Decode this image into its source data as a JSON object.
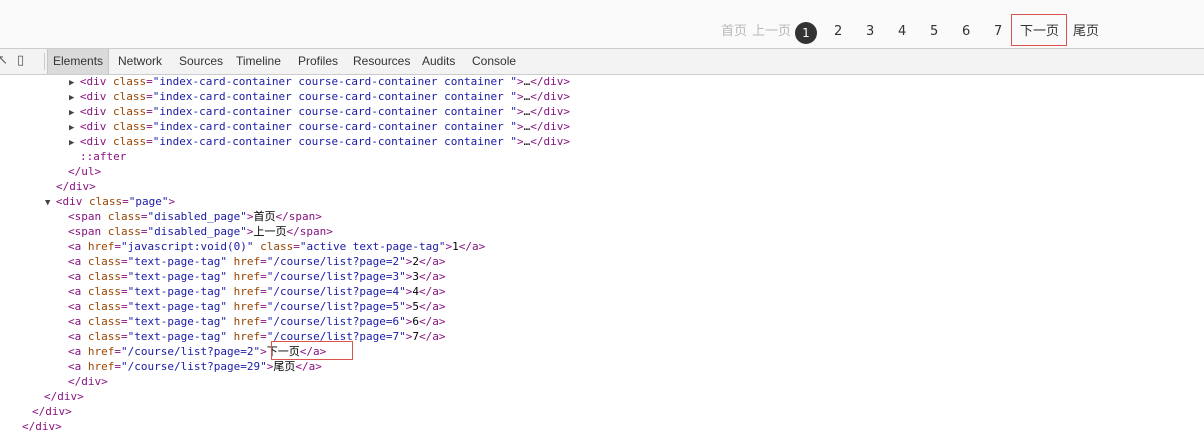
{
  "pagination": {
    "first": "首页",
    "prev": "上一页",
    "pages": [
      "1",
      "2",
      "3",
      "4",
      "5",
      "6",
      "7"
    ],
    "next": "下一页",
    "last": "尾页"
  },
  "devtools": {
    "tabs": [
      "Elements",
      "Network",
      "Sources",
      "Timeline",
      "Profiles",
      "Resources",
      "Audits",
      "Console"
    ],
    "selected_tab": "Elements"
  },
  "dom_lines": [
    "<div class=\"index-card-container course-card-container container \">…</div>",
    "<div class=\"index-card-container course-card-container container \">…</div>",
    "<div class=\"index-card-container course-card-container container \">…</div>",
    "<div class=\"index-card-container course-card-container container \">…</div>",
    "<div class=\"index-card-container course-card-container container \">…</div>",
    "::after",
    "</ul>",
    "</div>",
    "<div class=\"page\">",
    "<span class=\"disabled_page\">首页</span>",
    "<span class=\"disabled_page\">上一页</span>",
    "<a href=\"javascript:void(0)\" class=\"active text-page-tag\">1</a>",
    "<a class=\"text-page-tag\" href=\"/course/list?page=2\">2</a>",
    "<a class=\"text-page-tag\" href=\"/course/list?page=3\">3</a>",
    "<a class=\"text-page-tag\" href=\"/course/list?page=4\">4</a>",
    "<a class=\"text-page-tag\" href=\"/course/list?page=5\">5</a>",
    "<a class=\"text-page-tag\" href=\"/course/list?page=6\">6</a>",
    "<a class=\"text-page-tag\" href=\"/course/list?page=7\">7</a>",
    "<a href=\"/course/list?page=2\">下一页</a>",
    "<a href=\"/course/list?page=29\">尾页</a>",
    "</div>",
    "</div>",
    "</div>",
    "</div>"
  ]
}
